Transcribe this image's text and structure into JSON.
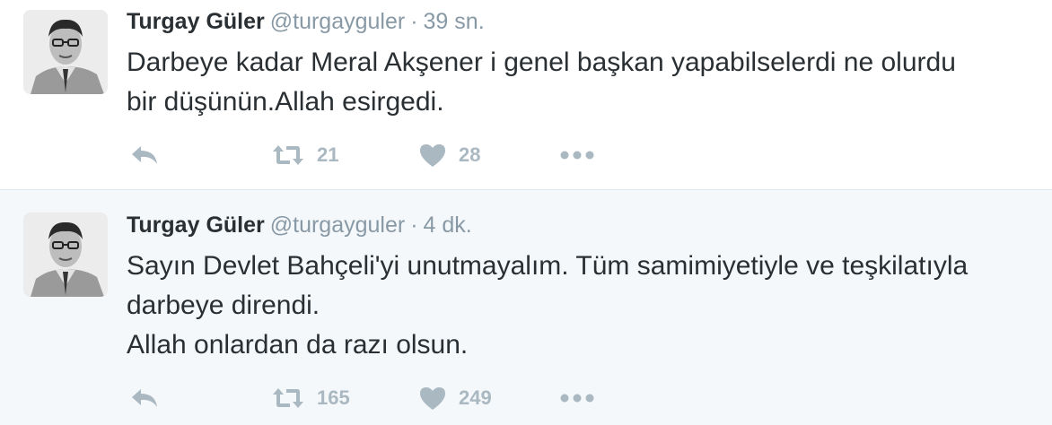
{
  "colors": {
    "name": "#292f33",
    "meta": "#8899a6",
    "action": "#aab8c2",
    "divider": "#e1e8ed",
    "highlight_bg": "#f5f8fa"
  },
  "icons": {
    "reply": "reply-arrow-icon",
    "retweet": "retweet-icon",
    "like": "heart-icon",
    "more": "ellipsis-icon"
  },
  "tweets": [
    {
      "author": "Turgay Güler",
      "handle": "@turgayguler",
      "separator": "·",
      "time": "39 sn.",
      "lines": [
        "Darbeye kadar Meral Akşener i genel başkan yapabilselerdi ne olurdu",
        "bir düşünün.Allah esirgedi."
      ],
      "retweets": "21",
      "likes": "28"
    },
    {
      "author": "Turgay Güler",
      "handle": "@turgayguler",
      "separator": "·",
      "time": "4 dk.",
      "lines": [
        "Sayın Devlet Bahçeli'yi unutmayalım. Tüm samimiyetiyle ve teşkilatıyla",
        "darbeye direndi.",
        "Allah onlardan da razı olsun."
      ],
      "retweets": "165",
      "likes": "249"
    }
  ]
}
